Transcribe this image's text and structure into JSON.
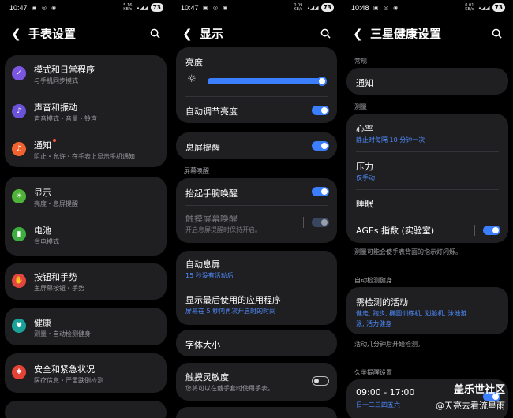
{
  "status": {
    "p1": {
      "time": "10:47",
      "net": "5.16 KB/s",
      "batt": "73"
    },
    "p2": {
      "time": "10:47",
      "net": "0.09 KB/s",
      "batt": "73"
    },
    "p3": {
      "time": "10:48",
      "net": "0.01 KB/s",
      "batt": "73"
    }
  },
  "p1": {
    "title": "手表设置",
    "groups": [
      [
        {
          "title": "模式和日常程序",
          "sub": "与手机同步模式",
          "color": "#7b56e0",
          "icon": "mode-icon"
        },
        {
          "title": "声音和振动",
          "sub": "声音模式・音量・铃声",
          "color": "#6b52d8",
          "icon": "sound-icon"
        },
        {
          "title": "通知",
          "sub": "阻止・允许・在手表上显示手机通知",
          "color": "#f1622e",
          "icon": "bell-icon"
        }
      ],
      [
        {
          "title": "显示",
          "sub": "亮度・息屏提醒",
          "color": "#4fb33a",
          "icon": "display-icon"
        },
        {
          "title": "电池",
          "sub": "省电模式",
          "color": "#3fae40",
          "icon": "battery-icon"
        }
      ],
      [
        {
          "title": "按钮和手势",
          "sub": "主屏幕按钮・手势",
          "color": "#e3463e",
          "icon": "hand-icon"
        }
      ],
      [
        {
          "title": "健康",
          "sub": "测量・自动检测健身",
          "color": "#1aa29a",
          "icon": "health-icon"
        }
      ],
      [
        {
          "title": "安全和紧急状况",
          "sub": "医疗信息・严重跌倒检测",
          "color": "#e64336",
          "icon": "emergency-icon"
        }
      ]
    ]
  },
  "p2": {
    "title": "显示",
    "brightness_label": "亮度",
    "brightness_level": 1.0,
    "auto_brightness": "自动调节亮度",
    "aod": "息屏提醒",
    "section_wake": "屏幕唤醒",
    "raise_wake": "抬起手腕唤醒",
    "touch_wake": "触摸屏幕唤醒",
    "touch_wake_sub": "开启息屏提醒时保持开启。",
    "auto_aod": "自动息屏",
    "auto_aod_sub": "15 秒没有活动后",
    "last_app": "显示最后使用的应用程序",
    "last_app_sub": "屏幕在 5 秒内再次开启时的时间",
    "font_size": "字体大小",
    "touch_sensitivity": "触摸灵敏度",
    "touch_sensitivity_sub": "您将可以在戴手套时使用手表。"
  },
  "p3": {
    "title": "三星健康设置",
    "section_general": "常规",
    "notifications": "通知",
    "section_measure": "测量",
    "heart_rate": "心率",
    "heart_rate_sub": "静止时每隔 10 分钟一次",
    "stress": "压力",
    "stress_sub": "仅手动",
    "sleep": "睡眠",
    "ages": "AGEs 指数 (实验室)",
    "measure_note": "测量可能会使手表背面的指示灯闪烁。",
    "section_auto": "自动检测健身",
    "workouts": "需检测的活动",
    "workouts_sub1": "健走, 跑步, 椭圆训练机, 划船机, 泳池游",
    "workouts_sub2": "泳, 活力健身",
    "workouts_note": "活动几分钟后开始检测。",
    "section_inactive": "久坐提醒设置",
    "inactive_time": "09:00 - 17:00",
    "inactive_days": "日一二三四五六"
  },
  "watermark": {
    "line1": "盖乐世社区",
    "line2": "@天亮去看流星雨"
  }
}
